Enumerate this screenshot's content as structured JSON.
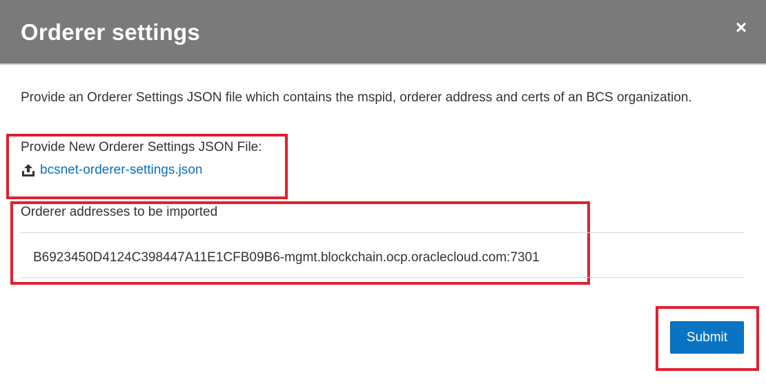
{
  "dialog": {
    "title": "Orderer settings",
    "close_label": "×"
  },
  "intro": {
    "text": "Provide an Orderer Settings JSON file which contains the mspid, orderer address and certs of an BCS organization."
  },
  "file_upload": {
    "label": "Provide New Orderer Settings JSON File:",
    "file_name": "bcsnet-orderer-settings.json",
    "icon": "upload-icon"
  },
  "orderer_addresses": {
    "label": "Orderer addresses to be imported",
    "items": [
      "B6923450D4124C398447A11E1CFB09B6-mgmt.blockchain.ocp.oraclecloud.com:7301"
    ]
  },
  "actions": {
    "submit_label": "Submit"
  },
  "colors": {
    "header": "#7a7a7a",
    "link": "#0b6fbf",
    "primary_button": "#0a74c4",
    "highlight": "#e0202f"
  }
}
